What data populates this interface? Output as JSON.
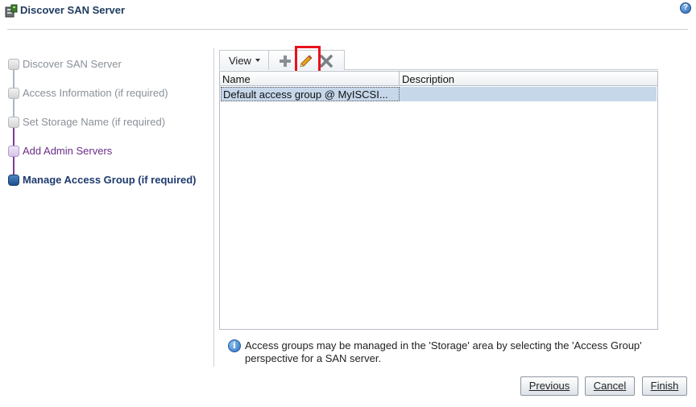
{
  "window": {
    "title": "Discover SAN Server",
    "icon": "server-app-icon",
    "help_icon": "help-icon"
  },
  "train": {
    "steps": [
      {
        "label": "Discover SAN Server",
        "state": "visited"
      },
      {
        "label": "Access Information (if required)",
        "state": "visited"
      },
      {
        "label": "Set Storage Name (if required)",
        "state": "visited"
      },
      {
        "label": "Add Admin Servers",
        "state": "next"
      },
      {
        "label": "Manage Access Group (if required)",
        "state": "current"
      }
    ]
  },
  "toolbar": {
    "view_label": "View",
    "add_icon": "plus-icon",
    "edit_icon": "pencil-icon",
    "delete_icon": "x-icon"
  },
  "table": {
    "columns": [
      "Name",
      "Description"
    ],
    "rows": [
      {
        "name": "Default access group @ MyISCSI...",
        "description": ""
      }
    ]
  },
  "info": {
    "text": "Access groups may be managed in the 'Storage' area by selecting the 'Access Group' perspective for a SAN server."
  },
  "buttons": {
    "previous": "Previous",
    "cancel": "Cancel",
    "finish": "Finish"
  },
  "colors": {
    "accent": "#1e3a6e",
    "visited_step": "#8a9098",
    "next_step": "#6a2c87",
    "row_selected": "#c6d7ea",
    "highlight": "#e8121c"
  }
}
